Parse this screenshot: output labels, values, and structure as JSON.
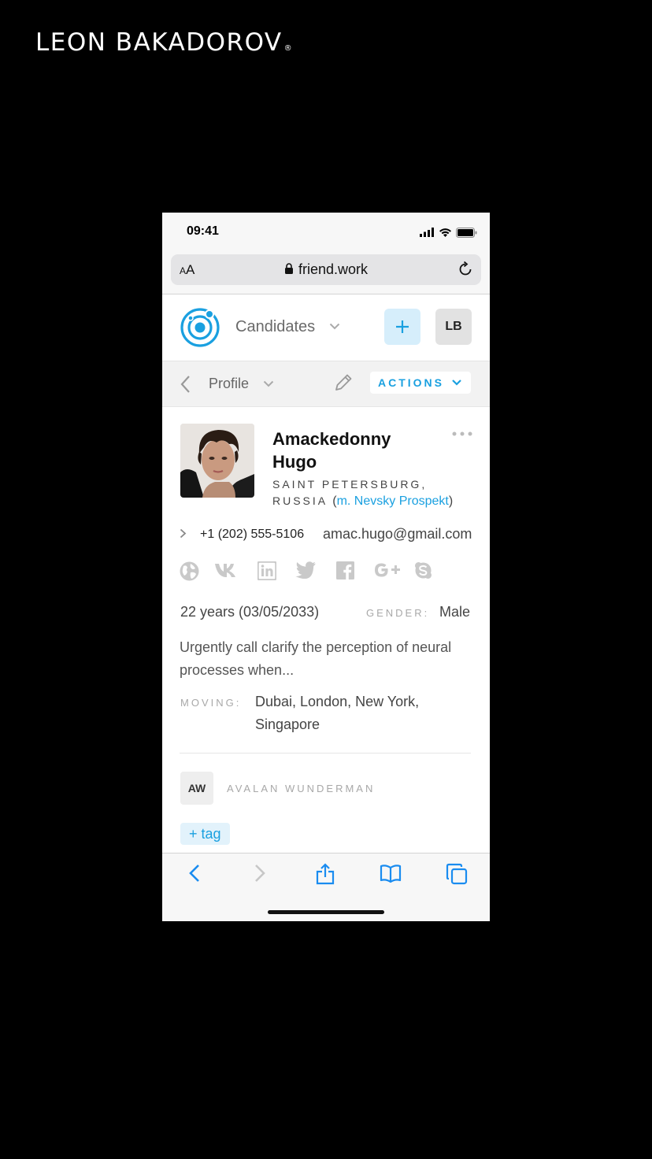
{
  "brand": {
    "text": "LEON BAKADOROV",
    "mark": "®"
  },
  "status_bar": {
    "time": "09:41"
  },
  "browser": {
    "text_size_label_small": "A",
    "text_size_label_large": "A",
    "url": "friend.work"
  },
  "app_header": {
    "section": "Candidates",
    "avatar_initials": "LB",
    "accent": "#1aa0e0"
  },
  "sub_nav": {
    "view": "Profile",
    "actions_label": "ACTIONS"
  },
  "profile": {
    "first_name": "Amackedonny",
    "last_name": "Hugo",
    "location_line1": "SAINT PETERSBURG,",
    "location_line2": "RUSSIA",
    "paren_open": "(",
    "metro": "m. Nevsky Prospekt",
    "paren_close": ")",
    "phone": "+1 (202) 555-5106",
    "email": "amac.hugo@gmail.com",
    "social_icons": [
      "globe-icon",
      "vk-icon",
      "linkedin-icon",
      "twitter-icon",
      "facebook-icon",
      "google-plus-icon",
      "skype-icon"
    ],
    "age": "22 years (03/05/2033)",
    "gender_label": "GENDER:",
    "gender": "Male",
    "description": "Urgently call clarify the perception of neural processes when...",
    "moving_label": "MOVING:",
    "moving": "Dubai, London, New York, Singapore"
  },
  "recruiter": {
    "initials": "AW",
    "name": "AVALAN WUNDERMAN"
  },
  "tag_button": "+ tag"
}
